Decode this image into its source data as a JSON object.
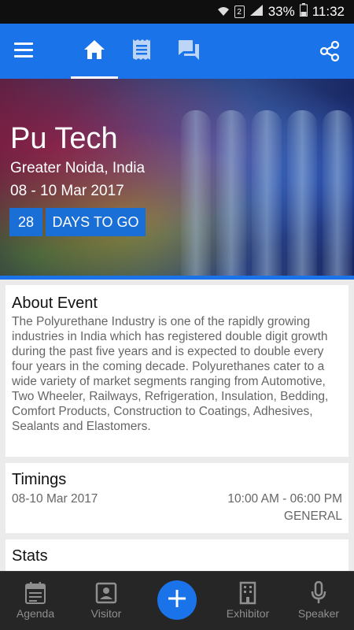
{
  "status_bar": {
    "battery": "33%",
    "time": "11:32",
    "sim": "2"
  },
  "tabs": [
    "home",
    "info",
    "chat"
  ],
  "event": {
    "title": "Pu Tech",
    "location": "Greater Noida, India",
    "dates": "08 - 10 Mar 2017",
    "days_count": "28",
    "days_label": "DAYS TO GO"
  },
  "about": {
    "heading": "About Event",
    "text": "The Polyurethane Industry is one of the rapidly growing industries in India which has registered double digit growth during the past five years and is expected to double every four years in the coming decade. Polyurethanes cater to a wide variety of market segments ranging from Automotive, Two Wheeler, Railways, Refrigeration, Insulation, Bedding, Comfort Products, Construction to Coatings, Adhesives, Sealants and Elastomers."
  },
  "timings": {
    "heading": "Timings",
    "date": "08-10 Mar 2017",
    "time": "10:00 AM - 06:00 PM",
    "type": "GENERAL"
  },
  "stats": {
    "heading": "Stats"
  },
  "bottom_nav": {
    "agenda": "Agenda",
    "visitor": "Visitor",
    "exhibitor": "Exhibitor",
    "speaker": "Speaker"
  },
  "colors": {
    "primary": "#1a73e8",
    "nav_bg": "#262626"
  }
}
